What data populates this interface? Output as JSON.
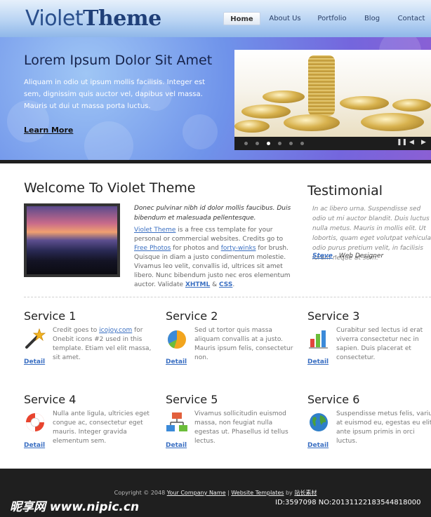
{
  "header": {
    "logo_light": "Violet",
    "logo_bold": "Theme",
    "nav": [
      {
        "label": "Home",
        "active": true
      },
      {
        "label": "About Us",
        "active": false
      },
      {
        "label": "Portfolio",
        "active": false
      },
      {
        "label": "Blog",
        "active": false
      },
      {
        "label": "Contact",
        "active": false
      }
    ]
  },
  "banner": {
    "title": "Lorem Ipsum Dolor Sit Amet",
    "text": "Aliquam in odio ut ipsum mollis facilisis. Integer est sem, dignissim quis auctor vel, dapibus vel massa. Mauris ut dui ut massa porta luctus.",
    "more_label": "Learn More",
    "slider": {
      "image_icon": "gold-coins-photo",
      "dots": 6,
      "active_dot": 3,
      "controls": [
        "pause-icon",
        "prev-icon",
        "next-icon"
      ]
    }
  },
  "welcome": {
    "title": "Welcome To Violet Theme",
    "photo_icon": "sunset-photo",
    "lead": "Donec pulvinar nibh id dolor mollis faucibus. Duis bibendum et malesuada pellentesque.",
    "body": {
      "link1": "Violet Theme",
      "text1": " is a free css template for your personal or commercial websites. Credits go to ",
      "link2": "Free Photos",
      "text2": " for photos and ",
      "link3": "forty-winks",
      "text3": " for brush. Quisque in diam a justo condimentum molestie. Vivamus leo velit, convallis id, ultrices sit amet libero. Nunc bibendum justo nec eros elementum auctor. Validate ",
      "link4": "XHTML",
      "text4": " & ",
      "link5": "CSS",
      "text5": "."
    }
  },
  "testimonial": {
    "title": "Testimonial",
    "quote": "In ac libero urna. Suspendisse sed odio ut mi auctor blandit. Duis luctus nulla metus. Mauris in mollis elit. Ut lobortis, quam eget volutpat vehicula, odio purus pretium velit, in facilisis lorem neque at sem.",
    "author_name": "Steve",
    "author_role": " - Web Designer"
  },
  "services": [
    {
      "title": "Service 1",
      "icon": "magic-wand-icon",
      "text_pre": "Credit goes to ",
      "link": "icojoy.com",
      "text_post": " for Onebit icons #2 used in this template. Etiam vel elit massa, sit amet.",
      "detail": "Detail"
    },
    {
      "title": "Service 2",
      "icon": "pie-chart-icon",
      "text_pre": "Sed ut tortor quis massa aliquam convallis at a justo. Mauris ipsum felis, consectetur non.",
      "link": "",
      "text_post": "",
      "detail": "Detail"
    },
    {
      "title": "Service 3",
      "icon": "bar-chart-icon",
      "text_pre": "Curabitur sed lectus id erat viverra consectetur nec in sapien. Duis placerat et consectetur.",
      "link": "",
      "text_post": "",
      "detail": "Detail"
    },
    {
      "title": "Service 4",
      "icon": "lifebuoy-icon",
      "text_pre": "Nulla ante ligula, ultricies eget congue ac, consectetur eget mauris. Integer gravida elementum sem.",
      "link": "",
      "text_post": "",
      "detail": "Detail"
    },
    {
      "title": "Service 5",
      "icon": "sitemap-icon",
      "text_pre": "Vivamus sollicitudin euismod massa, non feugiat nulla egestas ut. Phasellus id tellus lectus.",
      "link": "",
      "text_post": "",
      "detail": "Detail"
    },
    {
      "title": "Service 6",
      "icon": "globe-icon",
      "text_pre": "Suspendisse metus felis, varius at euismod eu, egestas eu elit ante ipsum primis in orci luctus.",
      "link": "",
      "text_post": "",
      "detail": "Detail"
    }
  ],
  "footer": {
    "copyright": "Copyright © 2048 ",
    "company_link": "Your Company Name",
    "sep": " | ",
    "templates_link": "Website Templates",
    "by": " by ",
    "source_link": "站长素材"
  },
  "watermark": {
    "left": "昵享网 www.nipic.cn",
    "right": "ID:3597098 NO:20131122183544818000"
  },
  "colors": {
    "accent": "#3a6fc2",
    "banner_violet": "#7466dd",
    "footer_bg": "#1f1f1f"
  }
}
